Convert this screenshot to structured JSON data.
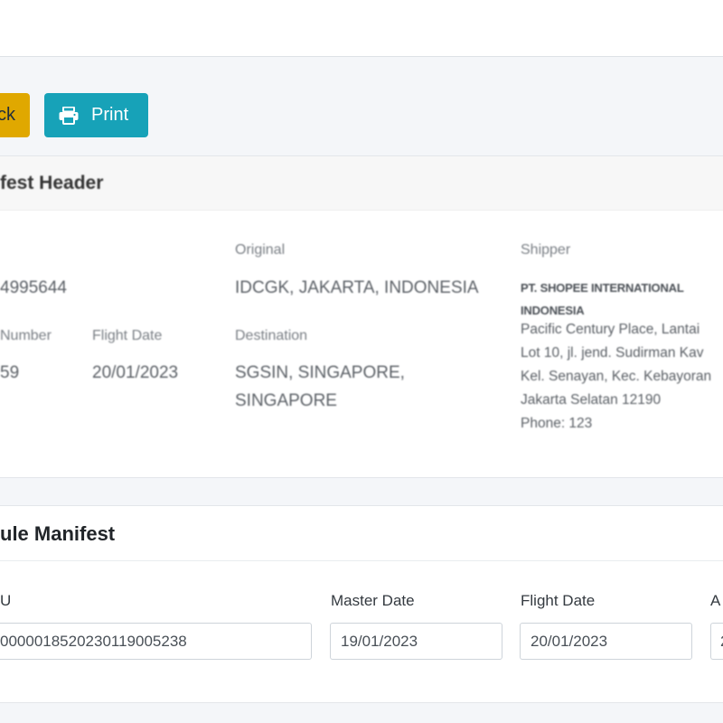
{
  "toolbar": {
    "back_label": "ck",
    "print_label": "Print",
    "back_color": "#e0a800",
    "print_color": "#17a2b8",
    "print_icon": "printer-icon"
  },
  "manifest_header": {
    "title": "fest Header",
    "fields": {
      "awb_label": "",
      "awb_value": "4995644",
      "original_label": "Original",
      "original_value": "IDCGK, JAKARTA, INDONESIA",
      "shipper_label": "Shipper",
      "flight_number_label": "Number",
      "flight_number_value": "59",
      "flight_date_label": "Flight Date",
      "flight_date_value": "20/01/2023",
      "destination_label": "Destination",
      "destination_line1": "SGSIN, SINGAPORE,",
      "destination_line2": "SINGAPORE"
    },
    "shipper": {
      "name_line1": "PT. SHOPEE INTERNATIONAL",
      "name_line2": "INDONESIA",
      "address_lines": [
        "Pacific Century Place, Lantai",
        "Lot 10, jl. jend. Sudirman Kav",
        "Kel. Senayan, Kec. Kebayoran",
        "Jakarta Selatan 12190",
        "Phone: 123"
      ]
    }
  },
  "single_manifest": {
    "title": "ule Manifest",
    "fields": {
      "awb_label": "U",
      "awb_value": "00000185202301190052​38",
      "master_date_label": "Master Date",
      "master_date_value": "19/01/2023",
      "flight_date_label": "Flight Date",
      "flight_date_value": "20/01/2023",
      "extra_label": "A",
      "extra_value": "2"
    }
  }
}
